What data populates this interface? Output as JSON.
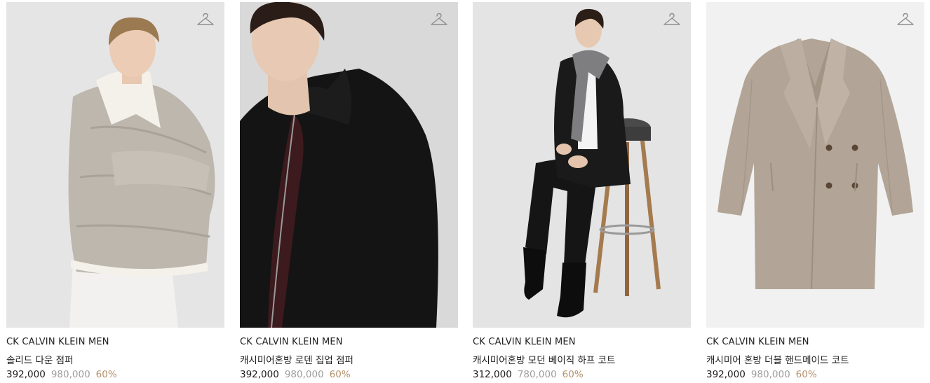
{
  "colors": {
    "discount": "#b5916b",
    "original_price": "#9d9d9d",
    "text": "#1d1d1d"
  },
  "products": [
    {
      "brand": "CK CALVIN KLEIN MEN",
      "name": "솔리드 다운 점퍼",
      "price": "392,000",
      "original_price": "980,000",
      "discount": "60%",
      "icon": "hanger-icon"
    },
    {
      "brand": "CK CALVIN KLEIN MEN",
      "name": "캐시미어혼방 로덴 집업 점퍼",
      "price": "392,000",
      "original_price": "980,000",
      "discount": "60%",
      "icon": "hanger-icon"
    },
    {
      "brand": "CK CALVIN KLEIN MEN",
      "name": "캐시미어혼방 모던 베이직 하프 코트",
      "price": "312,000",
      "original_price": "780,000",
      "discount": "60%",
      "icon": "hanger-icon"
    },
    {
      "brand": "CK CALVIN KLEIN MEN",
      "name": "캐시미어 혼방 더블 핸드메이드 코트",
      "price": "392,000",
      "original_price": "980,000",
      "discount": "60%",
      "icon": "hanger-icon"
    }
  ]
}
